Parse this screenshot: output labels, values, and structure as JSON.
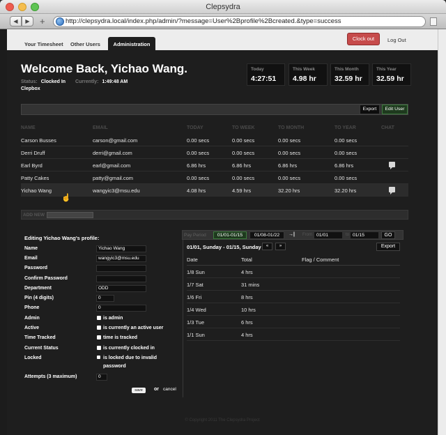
{
  "window": {
    "title": "Clepsydra"
  },
  "browser": {
    "url": "http://clepsydra.local/index.php/admin/?message=User%2Bprofile%2Bcreated.&type=success"
  },
  "nav": {
    "tabs": [
      "Your Timesheet",
      "Other Users",
      "Administration"
    ],
    "active_tab": "Administration",
    "clock_out": "Clock out",
    "log_out": "Log Out"
  },
  "header": {
    "welcome": "Welcome Back, Yichao Wang.",
    "status_label": "Status:",
    "status_value": "Clocked In",
    "currently_label": "Currently:",
    "currently_value": "1:49:48 AM",
    "org": "Clepbox"
  },
  "summary": [
    {
      "label": "Today",
      "value": "4:27:51"
    },
    {
      "label": "This Week",
      "value": "4.98 hr"
    },
    {
      "label": "This Month",
      "value": "32.59 hr"
    },
    {
      "label": "This Year",
      "value": "32.59 hr"
    }
  ],
  "actions": {
    "export": "Export",
    "edit_user": "Edit User"
  },
  "users_table": {
    "columns": [
      "NAME",
      "EMAIL",
      "TODAY",
      "TO WEEK",
      "TO MONTH",
      "TO YEAR",
      "CHAT"
    ],
    "rows": [
      {
        "name": "Carson Busses",
        "email": "carson@gmail.com",
        "today": "0.00 secs",
        "week": "0.00 secs",
        "month": "0.00 secs",
        "year": "0.00 secs",
        "chat": false
      },
      {
        "name": "Derri Druff",
        "email": "derri@gmail.com",
        "today": "0.00 secs",
        "week": "0.00 secs",
        "month": "0.00 secs",
        "year": "0.00 secs",
        "chat": false
      },
      {
        "name": "Earl Byrd",
        "email": "earl@gmail.com",
        "today": "6.86 hrs",
        "week": "6.86 hrs",
        "month": "6.86 hrs",
        "year": "6.86 hrs",
        "chat": true
      },
      {
        "name": "Patty Cakes",
        "email": "patty@gmail.com",
        "today": "0.00 secs",
        "week": "0.00 secs",
        "month": "0.00 secs",
        "year": "0.00 secs",
        "chat": false
      },
      {
        "name": "Yichao Wang",
        "email": "wangyic3@msu.edu",
        "today": "4.08 hrs",
        "week": "4.59 hrs",
        "month": "32.20 hrs",
        "year": "32.20 hrs",
        "chat": true
      }
    ]
  },
  "add_new": {
    "label": "ADD NEW",
    "value": ""
  },
  "edit_form": {
    "title": "Editing Yichao Wang's profile:",
    "name": {
      "label": "Name",
      "value": "Yichao Wang"
    },
    "email": {
      "label": "Email",
      "value": "wangyic3@msu.edu"
    },
    "password": {
      "label": "Password",
      "value": ""
    },
    "confirm_password": {
      "label": "Confirm Password",
      "value": ""
    },
    "department": {
      "label": "Department",
      "value": "ODD"
    },
    "pin": {
      "label": "Pin (4 digits)",
      "value": "0"
    },
    "phone": {
      "label": "Phone",
      "value": "0"
    },
    "admin": {
      "label": "Admin",
      "text": "is admin",
      "checked": true
    },
    "active": {
      "label": "Active",
      "text": "is currently an active user",
      "checked": true
    },
    "time_tracked": {
      "label": "Time Tracked",
      "text": "time is tracked",
      "checked": true
    },
    "current_status": {
      "label": "Current Status",
      "text": "is currently clocked in",
      "checked": true
    },
    "locked": {
      "label": "Locked",
      "text_line1": "is locked due to invalid",
      "text_line2": "password",
      "checked": false
    },
    "attempts": {
      "label": "Attempts (3 maximum)",
      "value": "0"
    },
    "save": "save",
    "or": "or",
    "cancel": "cancel"
  },
  "pay_period": {
    "label": "Pay Period",
    "periods": [
      "01/01-01/15",
      "01/08-01/22"
    ],
    "active_period": "01/01-01/15",
    "from_label": "From",
    "from": "01/01",
    "to_label": "to",
    "to": "01/15",
    "go": "GO",
    "range": "01/01, Sunday - 01/15, Sunday",
    "prev": "«",
    "next": "»",
    "export": "Export"
  },
  "timesheet": {
    "columns": [
      "Date",
      "Total",
      "Flag / Comment"
    ],
    "rows": [
      {
        "date": "1/8 Sun",
        "total": "4 hrs"
      },
      {
        "date": "1/7 Sat",
        "total": "31 mins"
      },
      {
        "date": "1/6 Fri",
        "total": "8 hrs"
      },
      {
        "date": "1/4 Wed",
        "total": "10 hrs"
      },
      {
        "date": "1/3 Tue",
        "total": "6 hrs"
      },
      {
        "date": "1/1 Sun",
        "total": "4 hrs"
      }
    ]
  },
  "footer": {
    "text": "© Copyright 2011 The Clepsydra Project"
  },
  "colors": {
    "accent_red": "#c64b4b",
    "background": "#1e1e1e",
    "active_green": "#1e3a1e"
  }
}
